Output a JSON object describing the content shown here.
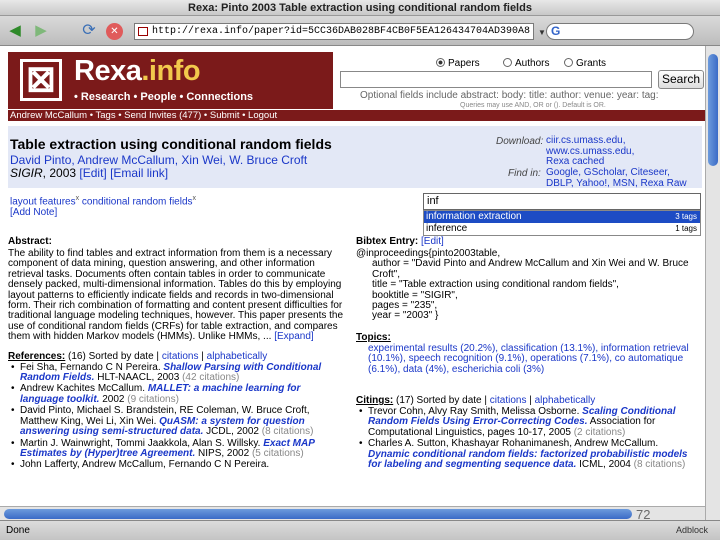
{
  "window": {
    "title": "Rexa: Pinto 2003 Table extraction using conditional random fields"
  },
  "browser": {
    "url": "http://rexa.info/paper?id=5CC36DAB028BF4CB0F5EA126434704AD390A8",
    "search_engine": "G",
    "status": "Done",
    "adblock": "Adblock",
    "page_number": "72"
  },
  "header": {
    "logo_mark": "⊠",
    "brand_main": "Rexa",
    "brand_dot": ".info",
    "tagline": "• Research • People • Connections",
    "radio_papers": "Papers",
    "radio_authors": "Authors",
    "radio_grants": "Grants",
    "search_button": "Search",
    "help": "Optional fields include abstract: body: title: author: venue: year: tag:",
    "help2": "Queries may use AND, OR or (). Default is OR."
  },
  "nav": "Andrew McCallum • Tags • Send Invites (477) • Submit • Logout",
  "paper": {
    "title": "Table extraction using conditional random fields",
    "authors": "David Pinto, Andrew McCallum, Xin Wei, W. Bruce Croft",
    "venue": "SIGIR",
    "year": ", 2003",
    "edit": "[Edit]",
    "email": "[Email link]",
    "download_label": "Download:",
    "download_links": [
      "ciir.cs.umass.edu,",
      "www.cs.umass.edu,",
      "Rexa cached"
    ],
    "findin_label": "Find in:",
    "findin_links": [
      "Google, GScholar, Citeseer,",
      "DBLP, Yahoo!, MSN, Rexa Raw"
    ]
  },
  "tags": {
    "tag1": "layout features",
    "tag2": "conditional random fields",
    "x": "x",
    "add_note": "[Add Note]"
  },
  "autocomplete": {
    "input": "inf",
    "items": [
      {
        "label": "information extraction",
        "count": "3 tags"
      },
      {
        "label": "inference",
        "count": "1 tags"
      }
    ]
  },
  "abstract": {
    "heading": "Abstract:",
    "text": "The ability to find tables and extract information from them is a necessary component of data mining, question answering, and other information retrieval tasks. Documents often contain tables in order to communicate densely packed, multi-dimensional information. Tables do this by employing layout patterns to efficiently indicate fields and records in two-dimensional form. Their rich combination of formatting and content present difficulties for traditional language modeling techniques, however. This paper presents the use of conditional random fields (CRFs) for table extraction, and compares them with hidden Markov models (HMMs). Unlike HMMs, ...",
    "expand": "[Expand]"
  },
  "references": {
    "heading": "References:",
    "count_sort": " (16) Sorted by date | ",
    "citations_link": "citations",
    "alpha_link": "alphabetically",
    "items": [
      {
        "authors": "Fei Sha, Fernando C N Pereira.",
        "title": "Shallow Parsing with Conditional Random Fields.",
        "venue": "HLT-NAACL, 2003",
        "cites": "(42 citations)"
      },
      {
        "authors": "Andrew Kachites McCallum.",
        "title": "MALLET: a machine learning for language toolkit.",
        "venue": "2002",
        "cites": "(9 citations)"
      },
      {
        "authors": "David Pinto, Michael S. Brandstein, RE Coleman, W. Bruce Croft, Matthew King, Wei Li, Xin Wei.",
        "title": "QuASM: a system for question answering using semi-structured data.",
        "venue": "JCDL, 2002",
        "cites": "(8 citations)"
      },
      {
        "authors": "Martin J. Wainwright, Tommi Jaakkola, Alan S. Willsky.",
        "title": "Exact MAP Estimates by (Hyper)tree Agreement.",
        "venue": "NIPS, 2002",
        "cites": "(5 citations)"
      },
      {
        "authors": "John Lafferty, Andrew McCallum, Fernando C N Pereira.",
        "title": "",
        "venue": "",
        "cites": ""
      }
    ]
  },
  "bibtex": {
    "heading": "Bibtex Entry:",
    "edit": "[Edit]",
    "lines": [
      "@inproceedings{pinto2003table,",
      "author = \"David Pinto and Andrew McCallum and Xin Wei and W. Bruce Croft\",",
      "title = \"Table extraction using conditional random fields\",",
      "booktitle = \"SIGIR\",",
      "pages = \"235\",",
      "year = \"2003\" }"
    ]
  },
  "topics": {
    "heading": "Topics:",
    "text": "experimental results (20.2%), classification (13.1%), information retrieval (10.1%), speech recognition (9.1%), operations (7.1%), co automatique (6.1%), data (4%), escherichia coli (3%)"
  },
  "citings": {
    "heading": "Citings:",
    "count_sort": " (17) Sorted by date | ",
    "citations_link": "citations",
    "alpha_link": "alphabetically",
    "items": [
      {
        "authors": "Trevor Cohn, Alvy Ray Smith, Melissa Osborne.",
        "title": "Scaling Conditional Random Fields Using Error-Correcting Codes.",
        "venue": "Association for Computational Linguistics, pages 10-17, 2005",
        "cites": "(2 citations)"
      },
      {
        "authors": "Charles A. Sutton, Khashayar Rohanimanesh, Andrew McCallum.",
        "title": "Dynamic conditional random fields: factorized probabilistic models for labeling and segmenting sequence data.",
        "venue": "ICML, 2004",
        "cites": "(8 citations)"
      }
    ]
  }
}
